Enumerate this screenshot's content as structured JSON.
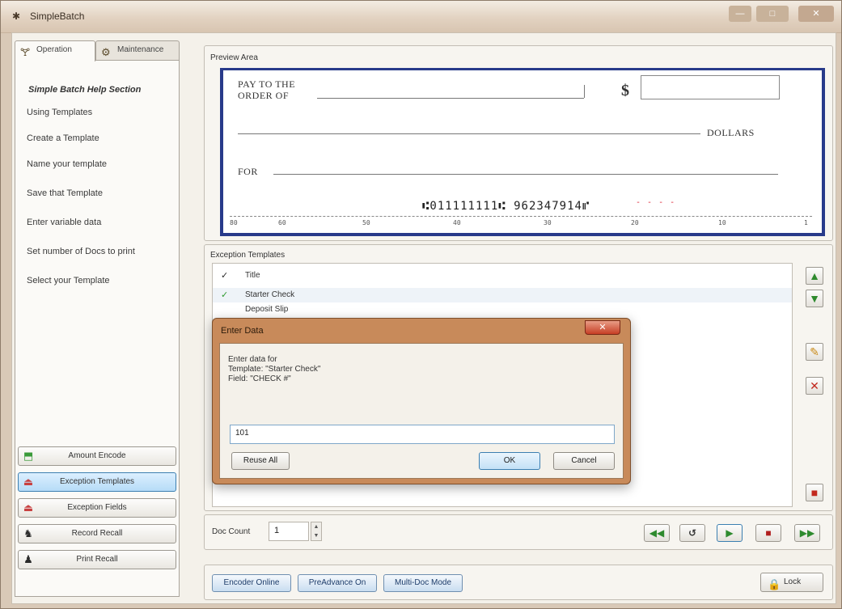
{
  "window": {
    "title": "SimpleBatch",
    "minimize": "—",
    "maximize": "□",
    "close": "✕"
  },
  "tabs": [
    {
      "label": "Operation",
      "icon": "flask-icon",
      "active": true
    },
    {
      "label": "Maintenance",
      "icon": "gear-icon",
      "active": false
    }
  ],
  "help": {
    "title": "Simple Batch Help Section",
    "items": [
      "Using Templates",
      "Create a Template",
      "Name your template",
      "Save that Template",
      "Enter variable data",
      "Set number of Docs to print",
      "Select your Template"
    ]
  },
  "side_buttons": [
    {
      "label": "Amount Encode",
      "icon": "encode-icon",
      "active": false
    },
    {
      "label": "Exception Templates",
      "icon": "template-icon",
      "active": true
    },
    {
      "label": "Exception Fields",
      "icon": "field-icon",
      "active": false
    },
    {
      "label": "Record Recall",
      "icon": "recall-icon",
      "active": false
    },
    {
      "label": "Print Recall",
      "icon": "print-icon",
      "active": false
    }
  ],
  "preview": {
    "label": "Preview Area",
    "pay_to_line1": "PAY TO THE",
    "pay_to_line2": "ORDER OF",
    "dollar_sign": "$",
    "dollars": "DOLLARS",
    "for": "FOR",
    "micr": "⑆011111111⑆  962347914⑈",
    "red_marks": "- - - -",
    "ruler_nums": [
      "80",
      "60",
      "50",
      "40",
      "30",
      "20",
      "10",
      "1"
    ]
  },
  "exceptions": {
    "label": "Exception Templates",
    "rows": [
      {
        "mark": "✓",
        "name": "Title",
        "checked": true
      },
      {
        "mark": "✓",
        "name": "Starter Check",
        "checked": true
      },
      {
        "mark": "",
        "name": "Deposit Slip",
        "checked": false
      }
    ]
  },
  "side_icons": {
    "up": "▲",
    "down": "▼",
    "edit": "✎",
    "delete": "✕",
    "save": "■"
  },
  "doc_count": {
    "label": "Doc Count",
    "value": "1"
  },
  "nav_buttons": [
    "◀◀",
    "↺",
    "▶",
    "■",
    "▶▶"
  ],
  "bottom_buttons": [
    {
      "label": "Encoder Online"
    },
    {
      "label": "PreAdvance On"
    },
    {
      "label": "Multi-Doc Mode"
    }
  ],
  "lock": {
    "label": "Lock"
  },
  "modal": {
    "title": "Enter Data",
    "close": "✕",
    "line1": "Enter data for",
    "line2": "Template: \"Starter Check\"",
    "line3": "Field: \"CHECK #\"",
    "input_value": "101",
    "reuse_label": "Reuse All",
    "ok_label": "OK",
    "cancel_label": "Cancel"
  },
  "colors": {
    "check_border": "#283a8a",
    "modal_frame": "#c88a5a",
    "accent_blue": "#3c7fb1"
  }
}
